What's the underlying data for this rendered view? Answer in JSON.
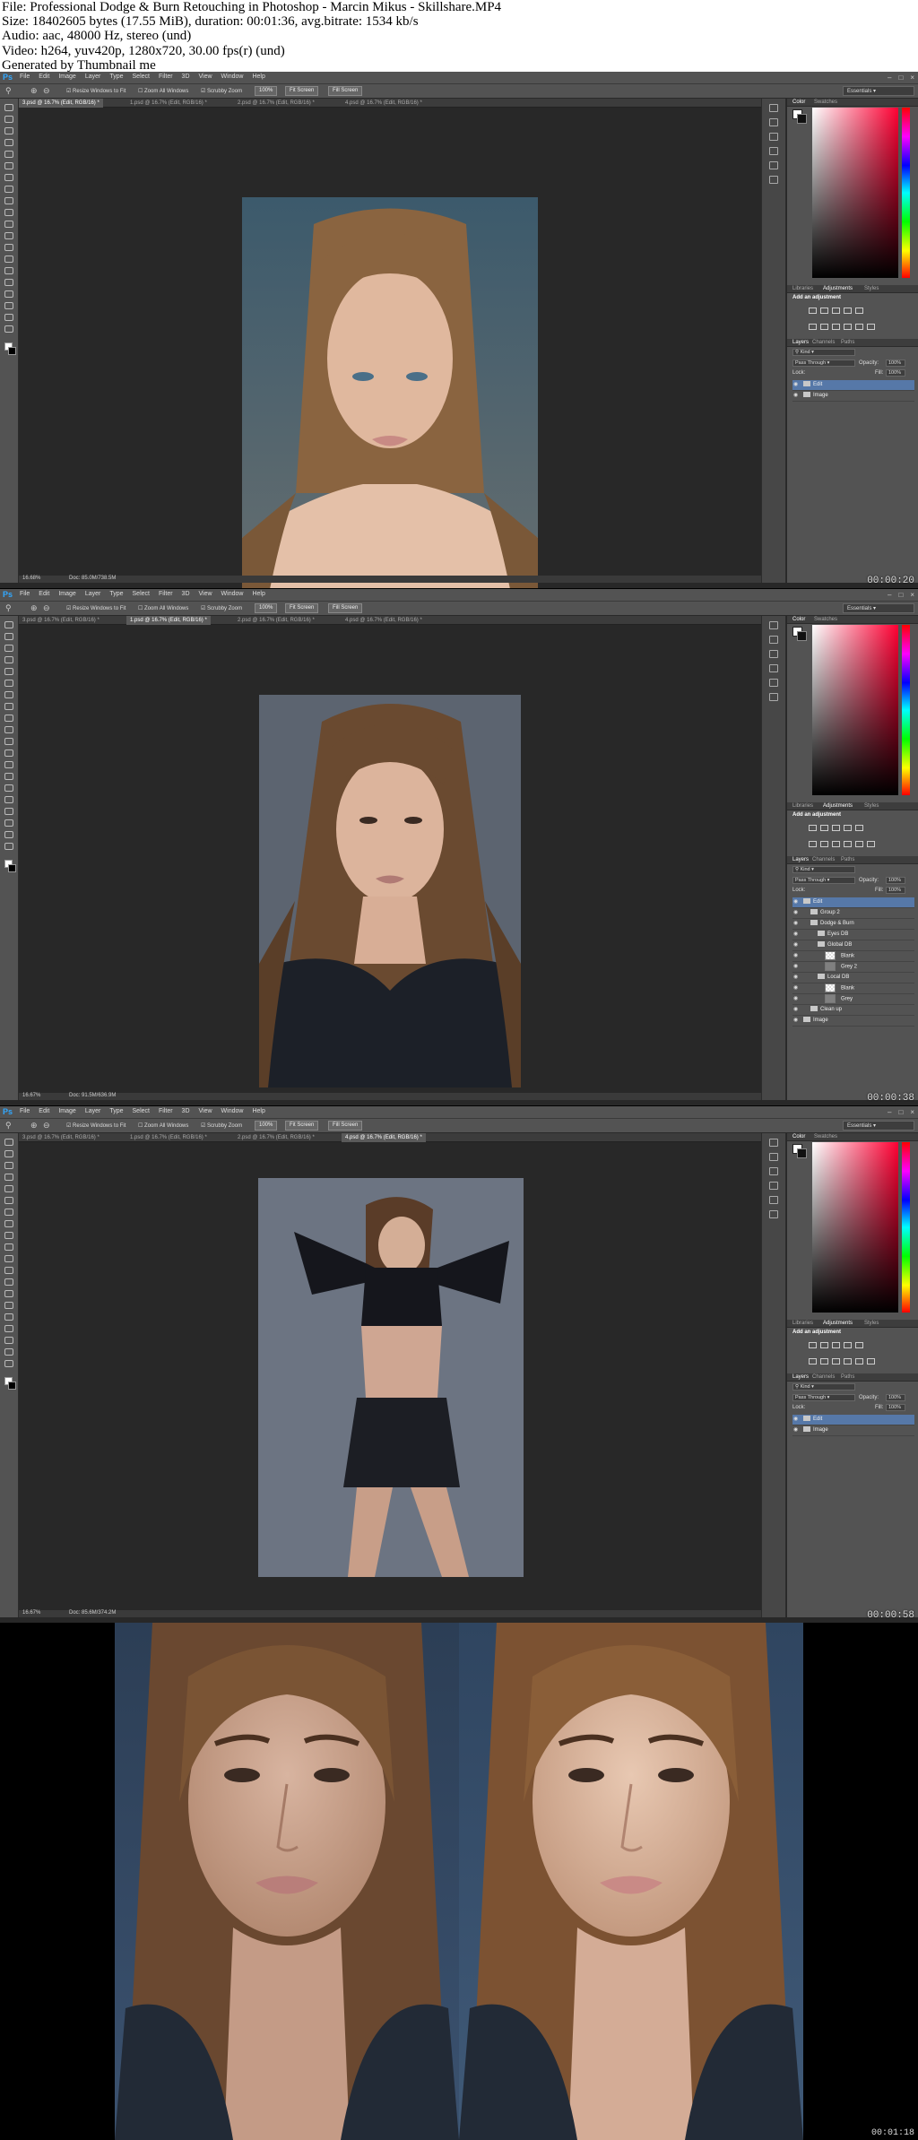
{
  "header": {
    "lines": [
      "File: Professional Dodge & Burn Retouching in Photoshop - Marcin Mikus - Skillshare.MP4",
      "Size: 18402605 bytes (17.55 MiB), duration: 00:01:36, avg.bitrate: 1534 kb/s",
      "Audio: aac, 48000 Hz, stereo (und)",
      "Video: h264, yuv420p, 1280x720, 30.00 fps(r) (und)",
      "Generated by Thumbnail me"
    ]
  },
  "app": {
    "logo": "Ps",
    "menus": [
      "File",
      "Edit",
      "Image",
      "Layer",
      "Type",
      "Select",
      "Filter",
      "3D",
      "View",
      "Window",
      "Help"
    ],
    "options": {
      "resize_windows": "Resize Windows to Fit",
      "zoom_all": "Zoom All Windows",
      "scrubby": "Scrubby Zoom",
      "btn_100": "100%",
      "btn_fit": "Fit Screen",
      "btn_fill": "Fill Screen",
      "workspace": "Essentials"
    },
    "panel_tabs": {
      "color": "Color",
      "swatches": "Swatches",
      "libraries": "Libraries",
      "adjustments": "Adjustments",
      "styles": "Styles",
      "layers": "Layers",
      "channels": "Channels",
      "paths": "Paths"
    },
    "add_adjustment": "Add an adjustment",
    "layers_controls": {
      "kind": "Kind",
      "blend": "Pass Through",
      "opacity_label": "Opacity:",
      "opacity": "100%",
      "lock_label": "Lock:",
      "fill_label": "Fill:",
      "fill": "100%"
    }
  },
  "frames": [
    {
      "tabs": [
        "3.psd @ 16.7% (Edit, RGB/16) *",
        "1.psd @ 16.7% (Edit, RGB/16) *",
        "2.psd @ 16.7% (Edit, RGB/16) *",
        "4.psd @ 16.7% (Edit, RGB/16) *"
      ],
      "active_tab": 0,
      "status_zoom": "16.68%",
      "status_doc": "Doc: 85.0M/738.5M",
      "timestamp": "00:00:20",
      "layers": [
        {
          "name": "Edit",
          "type": "folder",
          "indent": 0,
          "selected": true
        },
        {
          "name": "Image",
          "type": "folder",
          "indent": 0,
          "selected": false
        }
      ]
    },
    {
      "tabs": [
        "3.psd @ 16.7% (Edit, RGB/16) *",
        "1.psd @ 16.7% (Edit, RGB/16) *",
        "2.psd @ 16.7% (Edit, RGB/16) *",
        "4.psd @ 16.7% (Edit, RGB/16) *"
      ],
      "active_tab": 1,
      "status_zoom": "16.67%",
      "status_doc": "Doc: 91.5M/636.9M",
      "timestamp": "00:00:38",
      "layers": [
        {
          "name": "Edit",
          "type": "folder",
          "indent": 0,
          "selected": true
        },
        {
          "name": "Group 2",
          "type": "folder",
          "indent": 1,
          "selected": false
        },
        {
          "name": "Dodge & Burn",
          "type": "folder",
          "indent": 1,
          "selected": false
        },
        {
          "name": "Eyes DB",
          "type": "folder",
          "indent": 2,
          "selected": false
        },
        {
          "name": "Global DB",
          "type": "folder",
          "indent": 2,
          "selected": false
        },
        {
          "name": "Blank",
          "type": "layer-blank",
          "indent": 3,
          "selected": false
        },
        {
          "name": "Grey 2",
          "type": "layer-grey",
          "indent": 3,
          "selected": false
        },
        {
          "name": "Local DB",
          "type": "folder",
          "indent": 2,
          "selected": false
        },
        {
          "name": "Blank",
          "type": "layer-blank",
          "indent": 3,
          "selected": false
        },
        {
          "name": "Grey",
          "type": "layer-grey",
          "indent": 3,
          "selected": false
        },
        {
          "name": "Clean up",
          "type": "folder",
          "indent": 1,
          "selected": false
        },
        {
          "name": "Image",
          "type": "folder",
          "indent": 0,
          "selected": false
        }
      ]
    },
    {
      "tabs": [
        "3.psd @ 16.7% (Edit, RGB/16) *",
        "1.psd @ 16.7% (Edit, RGB/16) *",
        "2.psd @ 16.7% (Edit, RGB/16) *",
        "4.psd @ 16.7% (Edit, RGB/16) *"
      ],
      "active_tab": 3,
      "status_zoom": "16.67%",
      "status_doc": "Doc: 85.6M/374.2M",
      "timestamp": "00:00:58",
      "layers": [
        {
          "name": "Edit",
          "type": "folder",
          "indent": 0,
          "selected": true
        },
        {
          "name": "Image",
          "type": "folder",
          "indent": 0,
          "selected": false
        }
      ]
    }
  ],
  "final_timestamp": "00:01:18",
  "colors": {
    "ps_bg": "#282828",
    "ps_panel": "#535353",
    "selection": "#5678a8"
  }
}
